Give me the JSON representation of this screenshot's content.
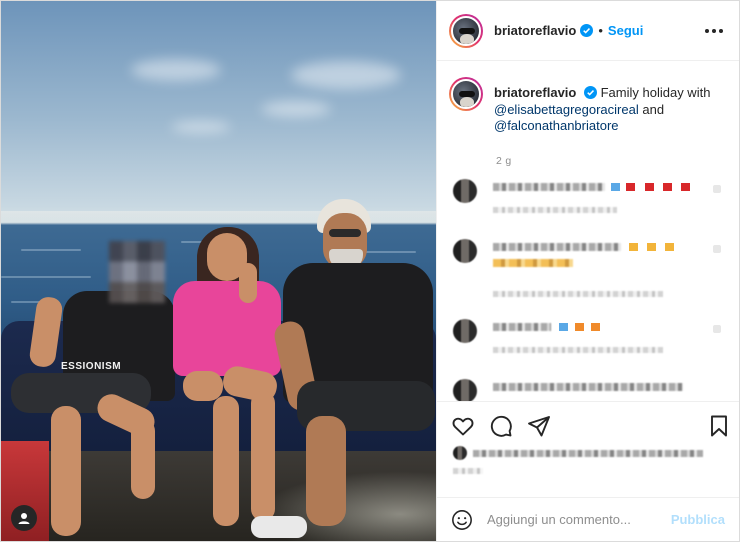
{
  "post": {
    "username": "briatoreflavio",
    "follow_label": "Segui",
    "separator": "•",
    "caption": {
      "username": "briatoreflavio",
      "text_1": "Family holiday with",
      "mention_1": "@elisabettagregoracireal",
      "text_2": "and",
      "mention_2": "@falconathanbriatore"
    },
    "time_ago": "2 g"
  },
  "photo_overlay_text": "ESSIONISM",
  "add_comment": {
    "placeholder": "Aggiungi un commento...",
    "publish_label": "Pubblica"
  },
  "icons": {
    "verified": "verified-badge-icon",
    "more": "more-options-icon",
    "like": "heart-icon",
    "comment": "comment-bubble-icon",
    "share": "paper-plane-icon",
    "save": "bookmark-icon",
    "emoji": "smiley-icon",
    "account": "account-circle-icon"
  },
  "colors": {
    "accent": "#0095f6",
    "publish_disabled": "#b2dffc",
    "mention": "#00376b",
    "text": "#262626",
    "muted": "#8e8e8e"
  }
}
